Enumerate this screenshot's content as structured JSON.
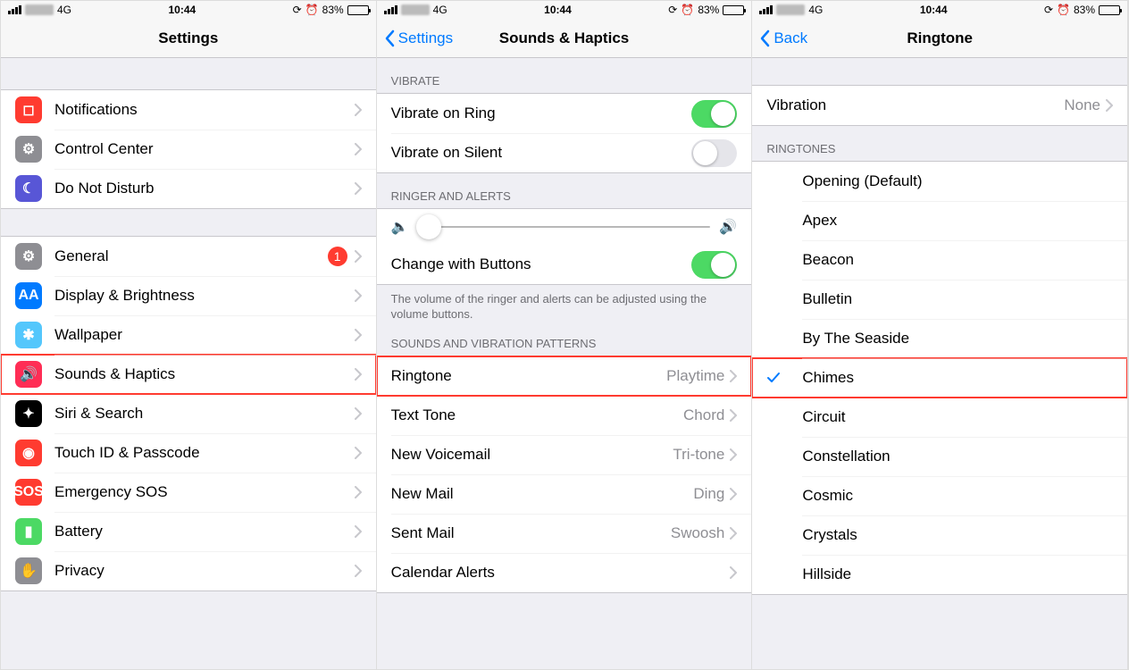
{
  "status": {
    "carrier": "4G",
    "time": "10:44",
    "battery_pct": "83%"
  },
  "screen1": {
    "title": "Settings",
    "group1": [
      {
        "icon": "notifications",
        "color": "#ff3b30",
        "label": "Notifications"
      },
      {
        "icon": "control-center",
        "color": "#8e8e93",
        "label": "Control Center"
      },
      {
        "icon": "dnd",
        "color": "#5856d6",
        "label": "Do Not Disturb"
      }
    ],
    "group2": [
      {
        "icon": "general",
        "color": "#8e8e93",
        "label": "General",
        "badge": "1"
      },
      {
        "icon": "display",
        "color": "#007aff",
        "label": "Display & Brightness"
      },
      {
        "icon": "wallpaper",
        "color": "#54c7fc",
        "label": "Wallpaper"
      },
      {
        "icon": "sounds",
        "color": "#ff2d55",
        "label": "Sounds & Haptics",
        "highlight": true
      },
      {
        "icon": "siri",
        "color": "#000",
        "label": "Siri & Search"
      },
      {
        "icon": "touchid",
        "color": "#ff3b30",
        "label": "Touch ID & Passcode"
      },
      {
        "icon": "sos",
        "color": "#ff3b30",
        "label": "Emergency SOS"
      },
      {
        "icon": "battery",
        "color": "#4cd964",
        "label": "Battery"
      },
      {
        "icon": "privacy",
        "color": "#8e8e93",
        "label": "Privacy"
      }
    ]
  },
  "screen2": {
    "back": "Settings",
    "title": "Sounds & Haptics",
    "vibrate_header": "VIBRATE",
    "vibrate": [
      {
        "label": "Vibrate on Ring",
        "on": true
      },
      {
        "label": "Vibrate on Silent",
        "on": false
      }
    ],
    "ringer_header": "RINGER AND ALERTS",
    "change_buttons_label": "Change with Buttons",
    "change_buttons_on": true,
    "ringer_footer": "The volume of the ringer and alerts can be adjusted using the volume buttons.",
    "patterns_header": "SOUNDS AND VIBRATION PATTERNS",
    "patterns": [
      {
        "label": "Ringtone",
        "value": "Playtime",
        "highlight": true
      },
      {
        "label": "Text Tone",
        "value": "Chord"
      },
      {
        "label": "New Voicemail",
        "value": "Tri-tone"
      },
      {
        "label": "New Mail",
        "value": "Ding"
      },
      {
        "label": "Sent Mail",
        "value": "Swoosh"
      },
      {
        "label": "Calendar Alerts",
        "value": ""
      }
    ]
  },
  "screen3": {
    "back": "Back",
    "title": "Ringtone",
    "vibration_label": "Vibration",
    "vibration_value": "None",
    "ringtones_header": "RINGTONES",
    "ringtones": [
      {
        "label": "Opening (Default)"
      },
      {
        "label": "Apex"
      },
      {
        "label": "Beacon"
      },
      {
        "label": "Bulletin"
      },
      {
        "label": "By The Seaside"
      },
      {
        "label": "Chimes",
        "checked": true,
        "highlight": true
      },
      {
        "label": "Circuit"
      },
      {
        "label": "Constellation"
      },
      {
        "label": "Cosmic"
      },
      {
        "label": "Crystals"
      },
      {
        "label": "Hillside"
      }
    ]
  }
}
